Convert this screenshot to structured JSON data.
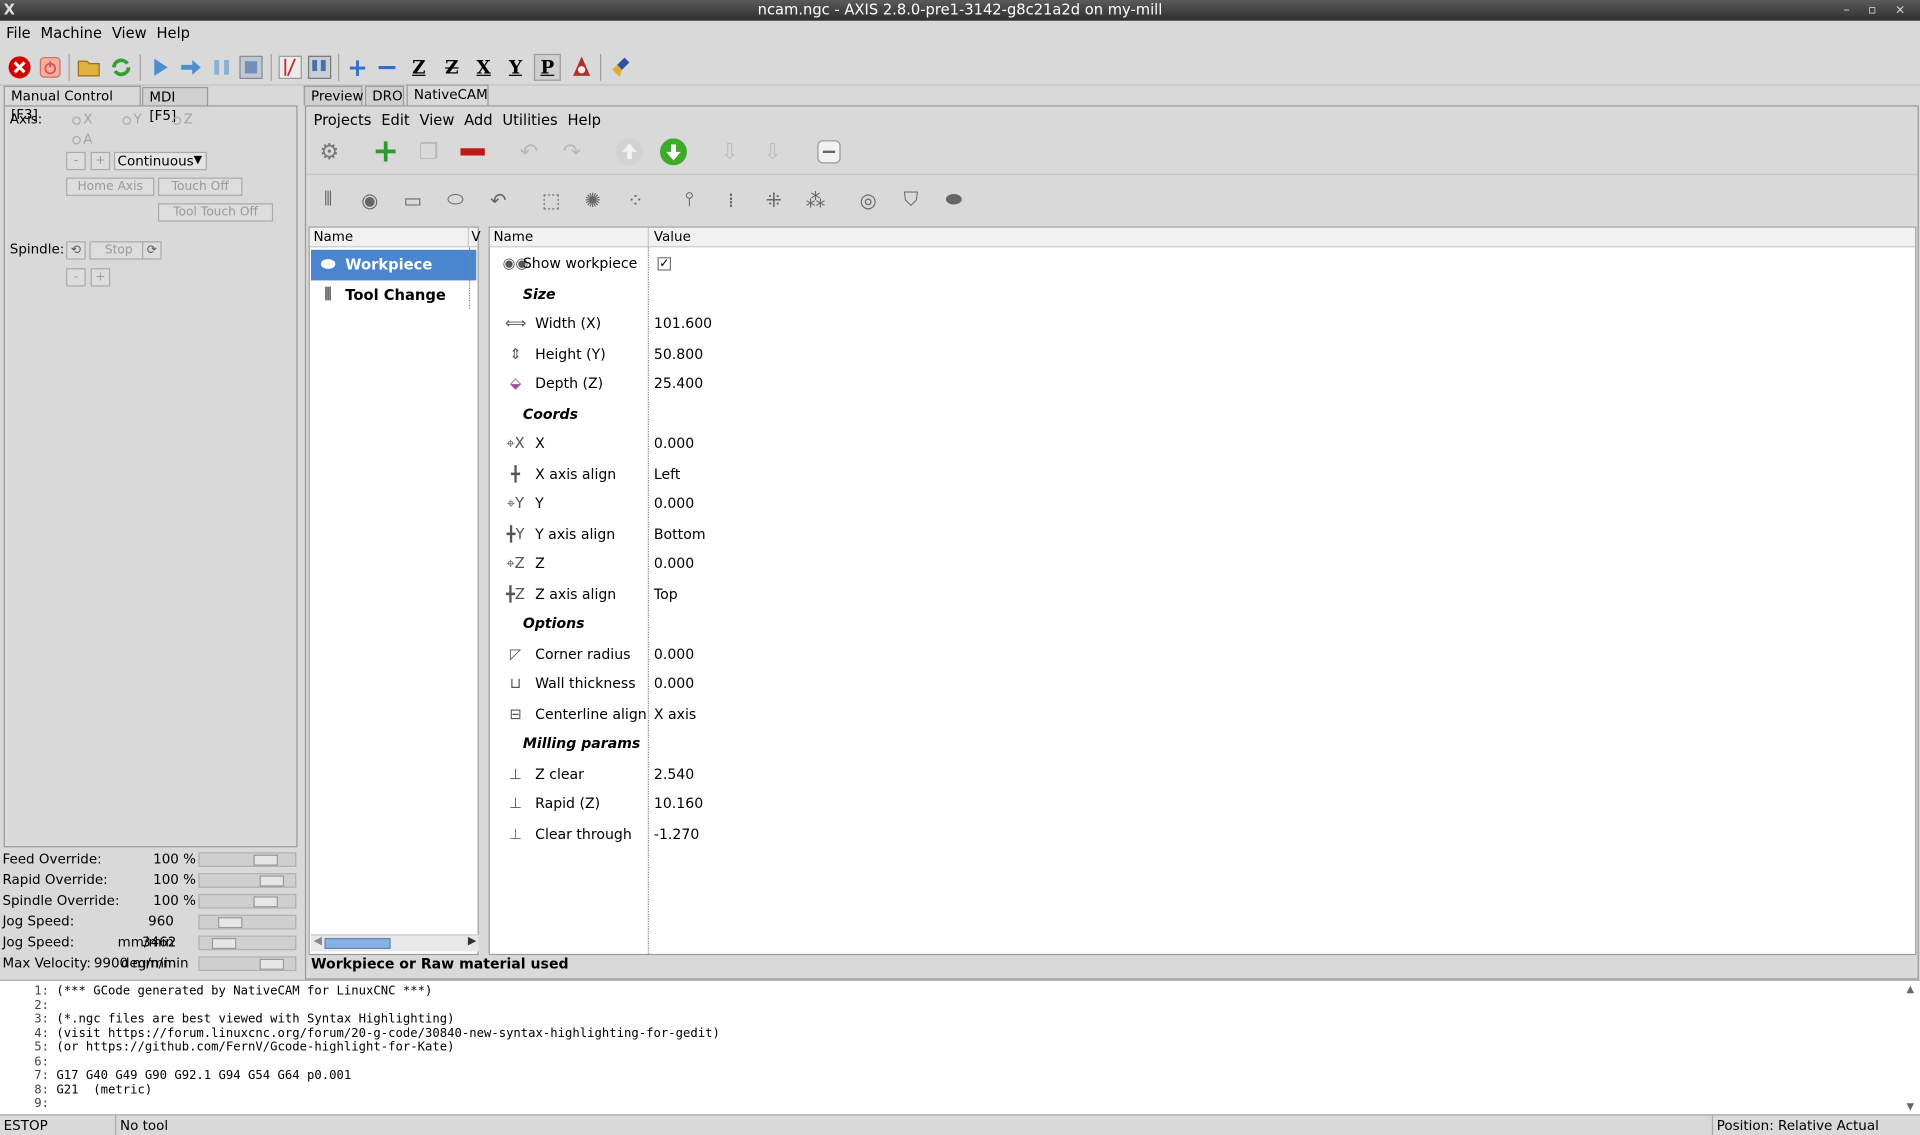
{
  "window": {
    "title": "ncam.ngc - AXIS 2.8.0-pre1-3142-g8c21a2d on my-mill",
    "logo": "X"
  },
  "menu": [
    "File",
    "Machine",
    "View",
    "Help"
  ],
  "toolbar": {
    "icons": [
      "estop-icon",
      "power-icon",
      "open-icon",
      "reload-icon",
      "run-icon",
      "step-icon",
      "pause-icon",
      "stop-icon",
      "block-delete-icon",
      "optional-stop-icon",
      "zoom-in-icon",
      "zoom-out-icon",
      "view-z-icon",
      "view-z2-icon",
      "view-x-icon",
      "view-y-icon",
      "view-p-icon",
      "rotate-icon",
      "clear-plot-icon"
    ],
    "view_letters": {
      "z": "Z",
      "z2": "Z",
      "x": "X",
      "y": "Y",
      "p": "P"
    }
  },
  "left": {
    "tabs": [
      "Manual Control [F3]",
      "MDI [F5]"
    ],
    "axis_label": "Axis:",
    "axes": [
      "X",
      "Y",
      "Z",
      "A"
    ],
    "jog_minus": "-",
    "jog_plus": "+",
    "jog_mode": "Continuous",
    "home_axis": "Home Axis",
    "touch_off": "Touch Off",
    "tool_touch_off": "Tool Touch Off",
    "spindle_label": "Spindle:",
    "spindle_stop": "Stop",
    "spindle_minus": "-",
    "spindle_plus": "+"
  },
  "overrides": [
    {
      "label": "Feed Override:",
      "value": "100 %",
      "level": 0.75
    },
    {
      "label": "Rapid Override:",
      "value": "100 %",
      "level": 0.85
    },
    {
      "label": "Spindle Override:",
      "value": "100 %",
      "level": 0.75
    },
    {
      "label": "Jog Speed:",
      "value": "960 mm/min",
      "level": 0.25
    },
    {
      "label": "Jog Speed:",
      "value": "3462 deg/min",
      "level": 0.18
    },
    {
      "label": "Max Velocity:",
      "value": "9900 mm/min",
      "level": 0.85
    }
  ],
  "main_tabs": [
    "Preview",
    "DRO",
    "NativeCAM"
  ],
  "ncam_menu": [
    "Projects",
    "Edit",
    "View",
    "Add",
    "Utilities",
    "Help"
  ],
  "tree": {
    "header_name": "Name",
    "header_v": "V",
    "items": [
      "Workpiece",
      "Tool Change"
    ]
  },
  "props": {
    "header_name": "Name",
    "header_value": "Value",
    "rows": [
      {
        "name": "Show workpiece",
        "value": "",
        "type": "check",
        "checked": true
      },
      {
        "name": "Size",
        "value": "",
        "type": "group"
      },
      {
        "name": "Width (X)",
        "value": "101.600",
        "type": "row"
      },
      {
        "name": "Height (Y)",
        "value": "50.800",
        "type": "row"
      },
      {
        "name": "Depth (Z)",
        "value": "25.400",
        "type": "row"
      },
      {
        "name": "Coords",
        "value": "",
        "type": "group"
      },
      {
        "name": "X",
        "value": "0.000",
        "type": "row"
      },
      {
        "name": "X axis align",
        "value": "Left",
        "type": "row"
      },
      {
        "name": "Y",
        "value": "0.000",
        "type": "row"
      },
      {
        "name": "Y axis align",
        "value": "Bottom",
        "type": "row"
      },
      {
        "name": "Z",
        "value": "0.000",
        "type": "row"
      },
      {
        "name": "Z axis align",
        "value": "Top",
        "type": "row"
      },
      {
        "name": "Options",
        "value": "",
        "type": "group"
      },
      {
        "name": "Corner radius",
        "value": "0.000",
        "type": "row"
      },
      {
        "name": "Wall thickness",
        "value": "0.000",
        "type": "row"
      },
      {
        "name": "Centerline align",
        "value": "X axis",
        "type": "row"
      },
      {
        "name": "Milling params",
        "value": "",
        "type": "group"
      },
      {
        "name": "Z clear",
        "value": "2.540",
        "type": "row"
      },
      {
        "name": "Rapid (Z)",
        "value": "10.160",
        "type": "row"
      },
      {
        "name": "Clear through",
        "value": "-1.270",
        "type": "row"
      }
    ]
  },
  "ncam_status": "Workpiece or Raw material used",
  "gcode": [
    {
      "n": "1:",
      "t": "(*** GCode generated by NativeCAM for LinuxCNC ***)"
    },
    {
      "n": "2:",
      "t": ""
    },
    {
      "n": "3:",
      "t": "(*.ngc files are best viewed with Syntax Highlighting)"
    },
    {
      "n": "4:",
      "t": "(visit https://forum.linuxcnc.org/forum/20-g-code/30840-new-syntax-highlighting-for-gedit)"
    },
    {
      "n": "5:",
      "t": "(or https://github.com/FernV/Gcode-highlight-for-Kate)"
    },
    {
      "n": "6:",
      "t": ""
    },
    {
      "n": "7:",
      "t": "G17 G40 G49 G90 G92.1 G94 G54 G64 p0.001"
    },
    {
      "n": "8:",
      "t": "G21  (metric)"
    },
    {
      "n": "9:",
      "t": ""
    }
  ],
  "status": {
    "estop": "ESTOP",
    "tool": "No tool",
    "position": "Position: Relative Actual"
  }
}
